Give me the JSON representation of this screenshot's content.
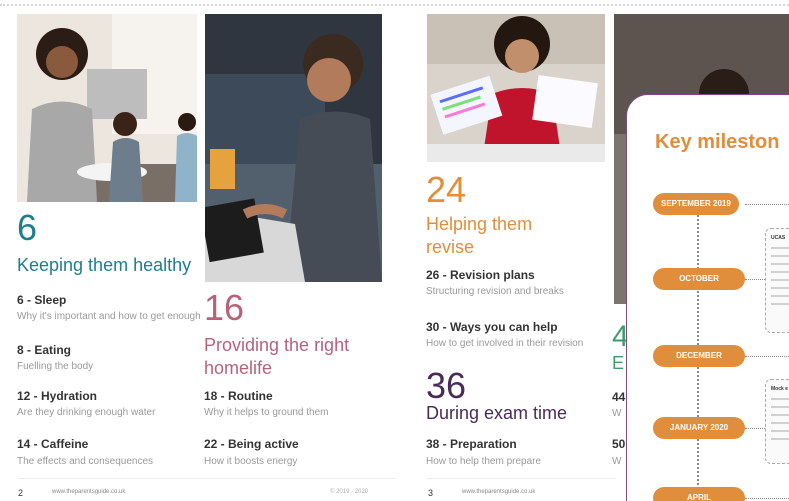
{
  "colors": {
    "teal": "#1f7d8c",
    "rose": "#b5637a",
    "orange": "#e08e3b",
    "purple": "#4a2a57",
    "green": "#3e9b6a"
  },
  "sections": {
    "s6": {
      "number": "6",
      "title": "Keeping them healthy"
    },
    "s16": {
      "number": "16",
      "title_line1": "Providing the right",
      "title_line2": "homelife"
    },
    "s24": {
      "number": "24",
      "title_line1": "Helping them",
      "title_line2": "revise"
    },
    "s36": {
      "number": "36",
      "title": "During exam time"
    },
    "s4x": {
      "number": "4",
      "title": "E"
    }
  },
  "items": {
    "sleep": {
      "title": "6 - Sleep",
      "sub": "Why it's important and how to get enough"
    },
    "eating": {
      "title": "8 - Eating",
      "sub": "Fuelling the body"
    },
    "hydration": {
      "title": "12 - Hydration",
      "sub": "Are they drinking enough water"
    },
    "caffeine": {
      "title": "14 - Caffeine",
      "sub": "The effects and consequences"
    },
    "routine": {
      "title": "18 - Routine",
      "sub": "Why it helps to ground them"
    },
    "active": {
      "title": "22 - Being active",
      "sub": "How it boosts energy"
    },
    "revision": {
      "title": "26 - Revision plans",
      "sub": "Structuring revision and breaks"
    },
    "help": {
      "title": "30 - Ways you can help",
      "sub": "How to get involved in their revision"
    },
    "prep": {
      "title": "38 - Preparation",
      "sub": "How to help them prepare"
    },
    "cut44": {
      "title": "44",
      "sub": "W"
    },
    "cut50": {
      "title": "50",
      "sub": "W"
    }
  },
  "footer": {
    "left_page": "2",
    "left_url": "www.theparentsguide.co.uk",
    "copyright": "© 2019 - 2020",
    "right_page": "3",
    "right_url": "www.theparentsguide.co.uk"
  },
  "milestones": {
    "title": "Key mileston",
    "pills": [
      "SEPTEMBER 2019",
      "OCTOBER",
      "DECEMBER",
      "JANUARY 2020",
      "APRIL"
    ],
    "note1_head": "UCAS",
    "note2_head": "Mock e"
  }
}
